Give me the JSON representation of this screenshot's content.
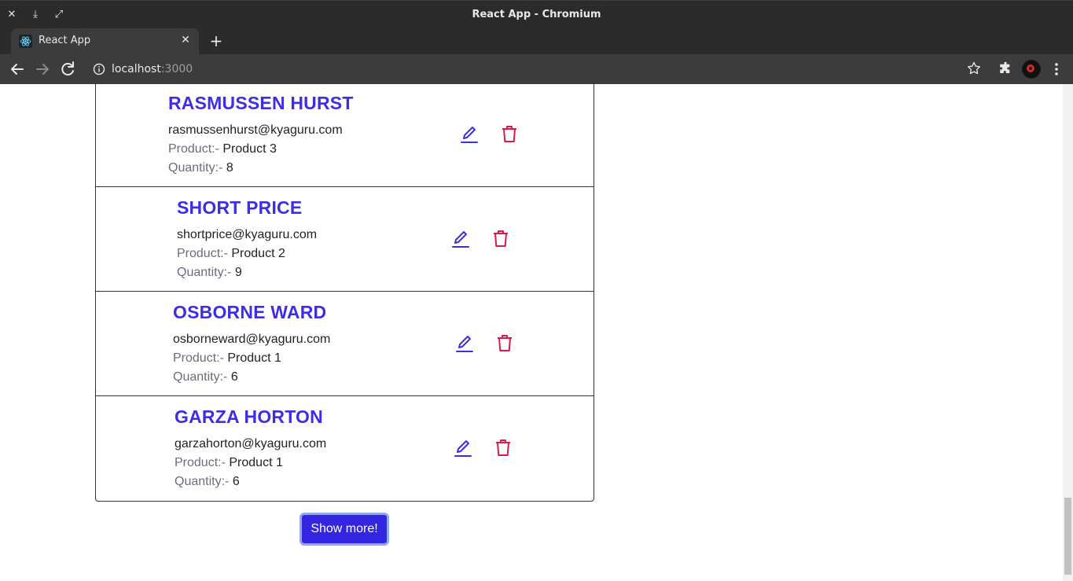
{
  "window": {
    "title": "React App - Chromium"
  },
  "tabs": [
    {
      "label": "React App"
    }
  ],
  "address_bar": {
    "host": "localhost",
    "port": ":3000"
  },
  "labels": {
    "product": "Product:-",
    "quantity": "Quantity:-"
  },
  "orders": [
    {
      "name": "RASMUSSEN HURST",
      "email": "rasmussenhurst@kyaguru.com",
      "product": "Product 3",
      "quantity": "8"
    },
    {
      "name": "SHORT PRICE",
      "email": "shortprice@kyaguru.com",
      "product": "Product 2",
      "quantity": "9"
    },
    {
      "name": "OSBORNE WARD",
      "email": "osborneward@kyaguru.com",
      "product": "Product 1",
      "quantity": "6"
    },
    {
      "name": "GARZA HORTON",
      "email": "garzahorton@kyaguru.com",
      "product": "Product 1",
      "quantity": "6"
    }
  ],
  "show_more_label": "Show more!",
  "colors": {
    "accent": "#3d2ee6",
    "delete": "#d81b4a",
    "button": "#3426e0"
  }
}
